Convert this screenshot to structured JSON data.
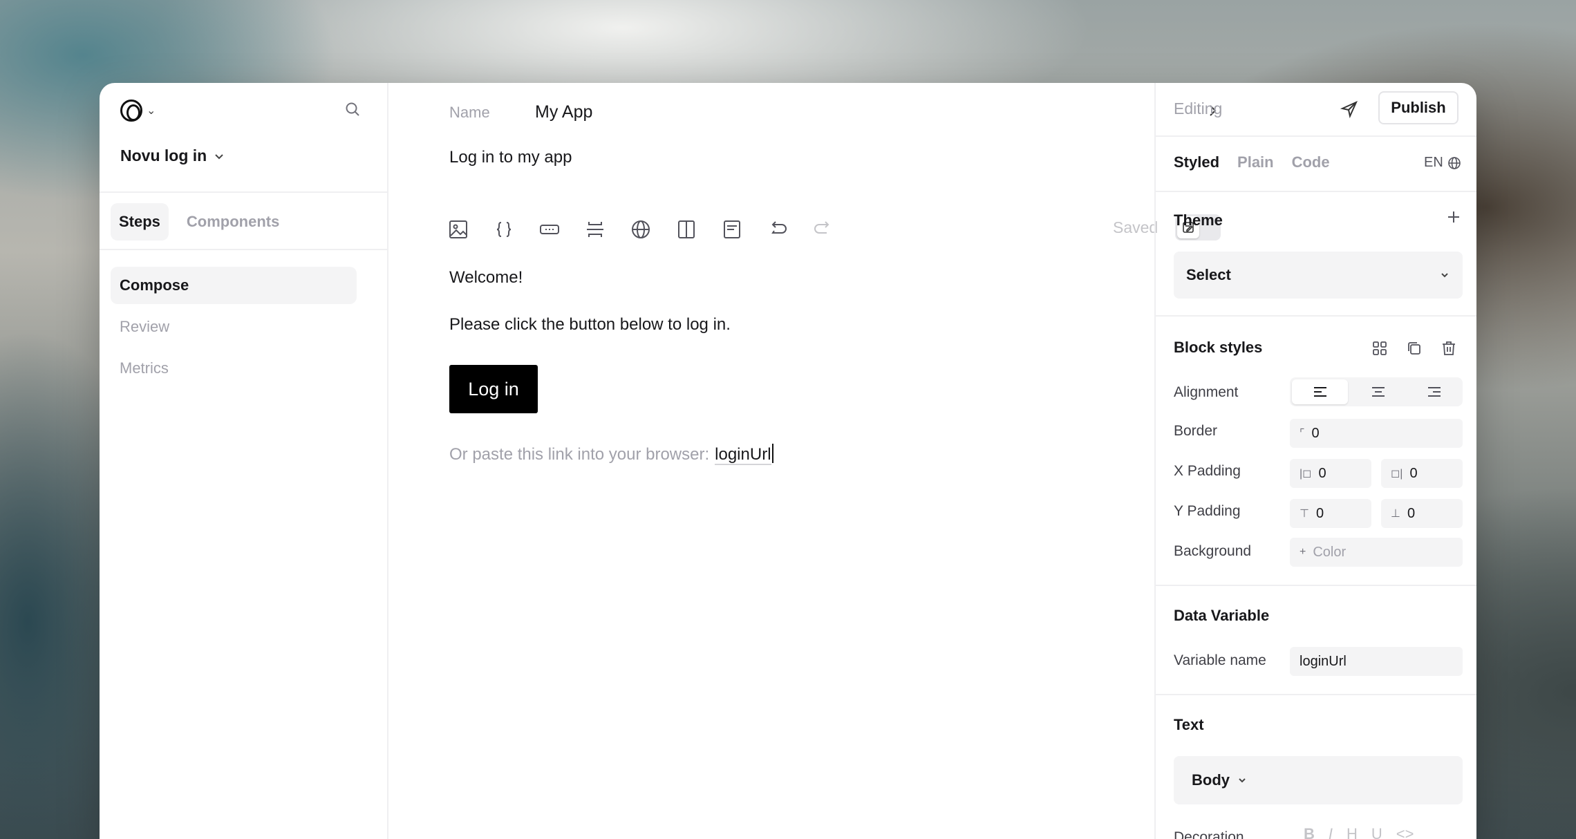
{
  "sidebar": {
    "project_name": "Novu log in",
    "tabs": [
      "Steps",
      "Components"
    ],
    "steps": [
      "Compose",
      "Review",
      "Metrics"
    ]
  },
  "editor": {
    "name_label": "Name",
    "name_value": "My App",
    "subject": "Log in to my app",
    "saved_label": "Saved",
    "toolbar": [
      "image-icon",
      "braces-icon",
      "button-block-icon",
      "spacer-icon",
      "globe-icon",
      "columns-icon",
      "section-icon",
      "undo-icon",
      "redo-icon"
    ],
    "welcome": "Welcome!",
    "instruction": "Please click the button below to log in.",
    "cta_label": "Log in",
    "paste_text": "Or paste this link into your browser:",
    "paste_variable": "loginUrl"
  },
  "panel": {
    "editing_label": "Editing",
    "publish_label": "Publish",
    "modes": [
      "Styled",
      "Plain",
      "Code"
    ],
    "language": "EN",
    "theme_title": "Theme",
    "theme_select": "Select",
    "block_styles_title": "Block styles",
    "alignment_label": "Alignment",
    "border_label": "Border",
    "border_value": "0",
    "x_padding_label": "X Padding",
    "x_padding_left": "0",
    "x_padding_right": "0",
    "y_padding_label": "Y Padding",
    "y_padding_top": "0",
    "y_padding_bottom": "0",
    "background_label": "Background",
    "background_value": "Color",
    "data_variable_title": "Data Variable",
    "variable_name_label": "Variable name",
    "variable_name_value": "loginUrl",
    "text_title": "Text",
    "text_style": "Body",
    "decoration_label": "Decoration"
  }
}
